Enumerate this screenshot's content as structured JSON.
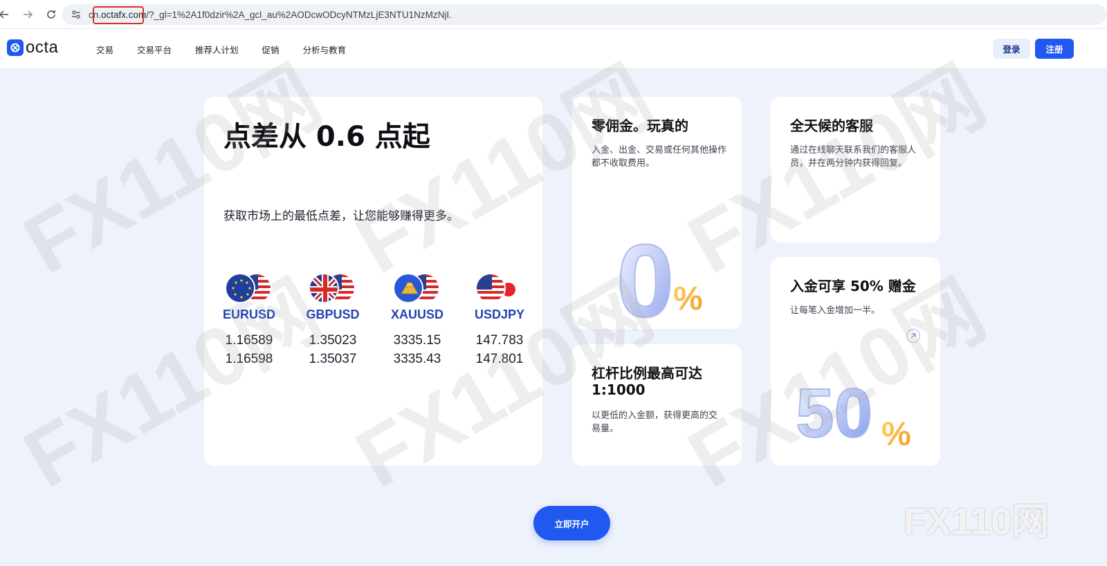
{
  "browser": {
    "url_prefix": "cn.",
    "url_domain": "octafx.com",
    "url_rest": "/?_gl=1%2A1f0dzir%2A_gcl_au%2AODcwODcyNTMzLjE3NTU1NzMzNjI."
  },
  "header": {
    "logo_text": "octa",
    "nav": [
      "交易",
      "交易平台",
      "推荐人计划",
      "促销",
      "分析与教育"
    ],
    "login_label": "登录",
    "signup_label": "注册"
  },
  "main_card": {
    "title": "点差从 0.6 点起",
    "subtitle": "获取市场上的最低点差，让您能够赚得更多。",
    "pairs": [
      {
        "name": "EURUSD",
        "bid": "1.16589",
        "ask": "1.16598"
      },
      {
        "name": "GBPUSD",
        "bid": "1.35023",
        "ask": "1.35037"
      },
      {
        "name": "XAUUSD",
        "bid": "3335.15",
        "ask": "3335.43"
      },
      {
        "name": "USDJPY",
        "bid": "147.783",
        "ask": "147.801"
      }
    ]
  },
  "zero_card": {
    "title": "零佣金。玩真的",
    "desc": "入金、出金、交易或任何其他操作都不收取费用。",
    "graphic_big": "0",
    "graphic_small": "%"
  },
  "support_card": {
    "title": "全天候的客服",
    "desc": "通过在线聊天联系我们的客服人员，并在两分钟内获得回复。"
  },
  "leverage_card": {
    "title": "杠杆比例最高可达 1:1000",
    "desc": "以更低的入金额，获得更高的交易量。"
  },
  "bonus_card": {
    "title": "入金可享 50% 赠金",
    "desc": "让每笔入金增加一半。",
    "graphic_big": "50",
    "graphic_small": "%"
  },
  "cta_label": "立即开户",
  "watermark": "FX110网",
  "colors": {
    "brand_blue": "#2058f0",
    "pair_name_blue": "#2242b4",
    "page_bg": "#eef2fa",
    "highlight_red": "#d6332e"
  }
}
